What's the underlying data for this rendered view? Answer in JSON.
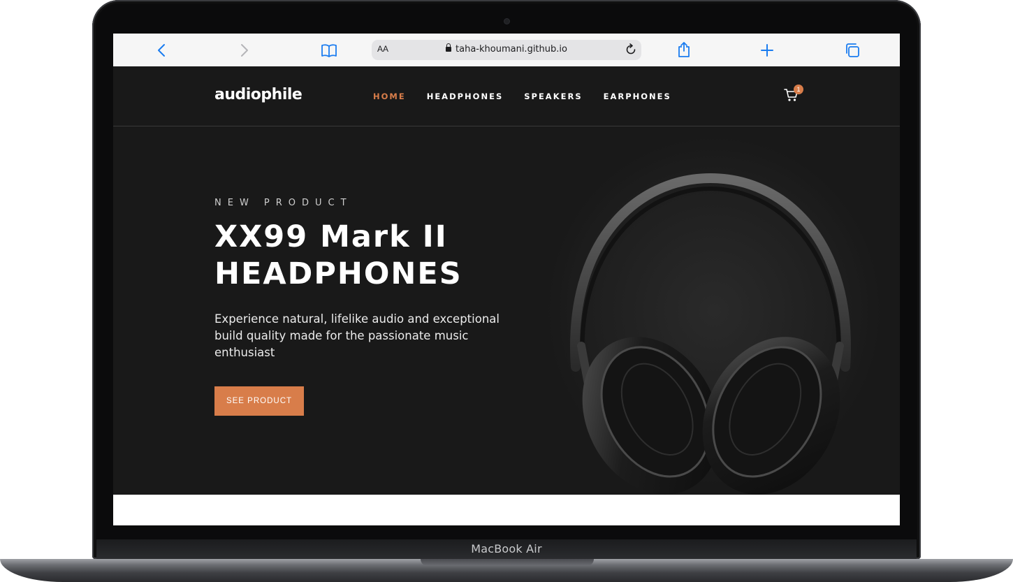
{
  "device": {
    "label": "MacBook Air"
  },
  "browser": {
    "text_size_label": "AA",
    "url": "taha-khoumani.github.io",
    "icons": [
      "back-icon",
      "forward-icon",
      "bookmarks-icon",
      "lock-icon",
      "reload-icon",
      "share-icon",
      "new-tab-icon",
      "tabs-icon"
    ],
    "accent": "#1a7cf0"
  },
  "site": {
    "logo": "audiophile",
    "nav": [
      {
        "label": "HOME",
        "active": true
      },
      {
        "label": "HEADPHONES",
        "active": false
      },
      {
        "label": "SPEAKERS",
        "active": false
      },
      {
        "label": "EARPHONES",
        "active": false
      }
    ],
    "cart": {
      "count": "1",
      "icon": "cart-icon"
    },
    "hero": {
      "eyebrow": "NEW PRODUCT",
      "title": "XX99 Mark II HEADPHONES",
      "description": "Experience natural, lifelike audio and exceptional build quality made for the passionate music enthusiast",
      "cta": "SEE PRODUCT",
      "image": "headphones-image"
    },
    "colors": {
      "background": "#191919",
      "accent": "#d87d4a",
      "text": "#ffffff"
    }
  }
}
